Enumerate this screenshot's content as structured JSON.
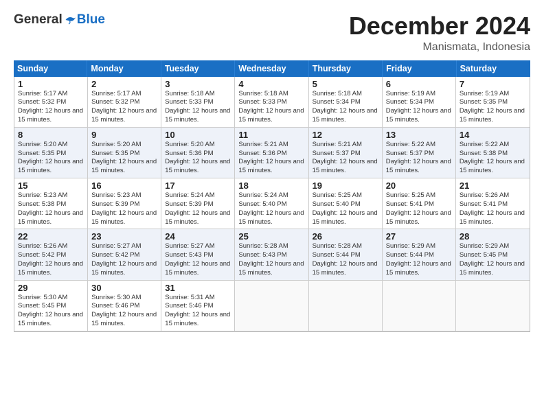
{
  "logo": {
    "general": "General",
    "blue": "Blue"
  },
  "title": "December 2024",
  "location": "Manismata, Indonesia",
  "days_of_week": [
    "Sunday",
    "Monday",
    "Tuesday",
    "Wednesday",
    "Thursday",
    "Friday",
    "Saturday"
  ],
  "weeks": [
    [
      {
        "day": "1",
        "sunrise": "5:17 AM",
        "sunset": "5:32 PM",
        "daylight": "12 hours and 15 minutes"
      },
      {
        "day": "2",
        "sunrise": "5:17 AM",
        "sunset": "5:32 PM",
        "daylight": "12 hours and 15 minutes"
      },
      {
        "day": "3",
        "sunrise": "5:18 AM",
        "sunset": "5:33 PM",
        "daylight": "12 hours and 15 minutes"
      },
      {
        "day": "4",
        "sunrise": "5:18 AM",
        "sunset": "5:33 PM",
        "daylight": "12 hours and 15 minutes"
      },
      {
        "day": "5",
        "sunrise": "5:18 AM",
        "sunset": "5:34 PM",
        "daylight": "12 hours and 15 minutes"
      },
      {
        "day": "6",
        "sunrise": "5:19 AM",
        "sunset": "5:34 PM",
        "daylight": "12 hours and 15 minutes"
      },
      {
        "day": "7",
        "sunrise": "5:19 AM",
        "sunset": "5:35 PM",
        "daylight": "12 hours and 15 minutes"
      }
    ],
    [
      {
        "day": "8",
        "sunrise": "5:20 AM",
        "sunset": "5:35 PM",
        "daylight": "12 hours and 15 minutes"
      },
      {
        "day": "9",
        "sunrise": "5:20 AM",
        "sunset": "5:35 PM",
        "daylight": "12 hours and 15 minutes"
      },
      {
        "day": "10",
        "sunrise": "5:20 AM",
        "sunset": "5:36 PM",
        "daylight": "12 hours and 15 minutes"
      },
      {
        "day": "11",
        "sunrise": "5:21 AM",
        "sunset": "5:36 PM",
        "daylight": "12 hours and 15 minutes"
      },
      {
        "day": "12",
        "sunrise": "5:21 AM",
        "sunset": "5:37 PM",
        "daylight": "12 hours and 15 minutes"
      },
      {
        "day": "13",
        "sunrise": "5:22 AM",
        "sunset": "5:37 PM",
        "daylight": "12 hours and 15 minutes"
      },
      {
        "day": "14",
        "sunrise": "5:22 AM",
        "sunset": "5:38 PM",
        "daylight": "12 hours and 15 minutes"
      }
    ],
    [
      {
        "day": "15",
        "sunrise": "5:23 AM",
        "sunset": "5:38 PM",
        "daylight": "12 hours and 15 minutes"
      },
      {
        "day": "16",
        "sunrise": "5:23 AM",
        "sunset": "5:39 PM",
        "daylight": "12 hours and 15 minutes"
      },
      {
        "day": "17",
        "sunrise": "5:24 AM",
        "sunset": "5:39 PM",
        "daylight": "12 hours and 15 minutes"
      },
      {
        "day": "18",
        "sunrise": "5:24 AM",
        "sunset": "5:40 PM",
        "daylight": "12 hours and 15 minutes"
      },
      {
        "day": "19",
        "sunrise": "5:25 AM",
        "sunset": "5:40 PM",
        "daylight": "12 hours and 15 minutes"
      },
      {
        "day": "20",
        "sunrise": "5:25 AM",
        "sunset": "5:41 PM",
        "daylight": "12 hours and 15 minutes"
      },
      {
        "day": "21",
        "sunrise": "5:26 AM",
        "sunset": "5:41 PM",
        "daylight": "12 hours and 15 minutes"
      }
    ],
    [
      {
        "day": "22",
        "sunrise": "5:26 AM",
        "sunset": "5:42 PM",
        "daylight": "12 hours and 15 minutes"
      },
      {
        "day": "23",
        "sunrise": "5:27 AM",
        "sunset": "5:42 PM",
        "daylight": "12 hours and 15 minutes"
      },
      {
        "day": "24",
        "sunrise": "5:27 AM",
        "sunset": "5:43 PM",
        "daylight": "12 hours and 15 minutes"
      },
      {
        "day": "25",
        "sunrise": "5:28 AM",
        "sunset": "5:43 PM",
        "daylight": "12 hours and 15 minutes"
      },
      {
        "day": "26",
        "sunrise": "5:28 AM",
        "sunset": "5:44 PM",
        "daylight": "12 hours and 15 minutes"
      },
      {
        "day": "27",
        "sunrise": "5:29 AM",
        "sunset": "5:44 PM",
        "daylight": "12 hours and 15 minutes"
      },
      {
        "day": "28",
        "sunrise": "5:29 AM",
        "sunset": "5:45 PM",
        "daylight": "12 hours and 15 minutes"
      }
    ],
    [
      {
        "day": "29",
        "sunrise": "5:30 AM",
        "sunset": "5:45 PM",
        "daylight": "12 hours and 15 minutes"
      },
      {
        "day": "30",
        "sunrise": "5:30 AM",
        "sunset": "5:46 PM",
        "daylight": "12 hours and 15 minutes"
      },
      {
        "day": "31",
        "sunrise": "5:31 AM",
        "sunset": "5:46 PM",
        "daylight": "12 hours and 15 minutes"
      },
      null,
      null,
      null,
      null
    ]
  ]
}
